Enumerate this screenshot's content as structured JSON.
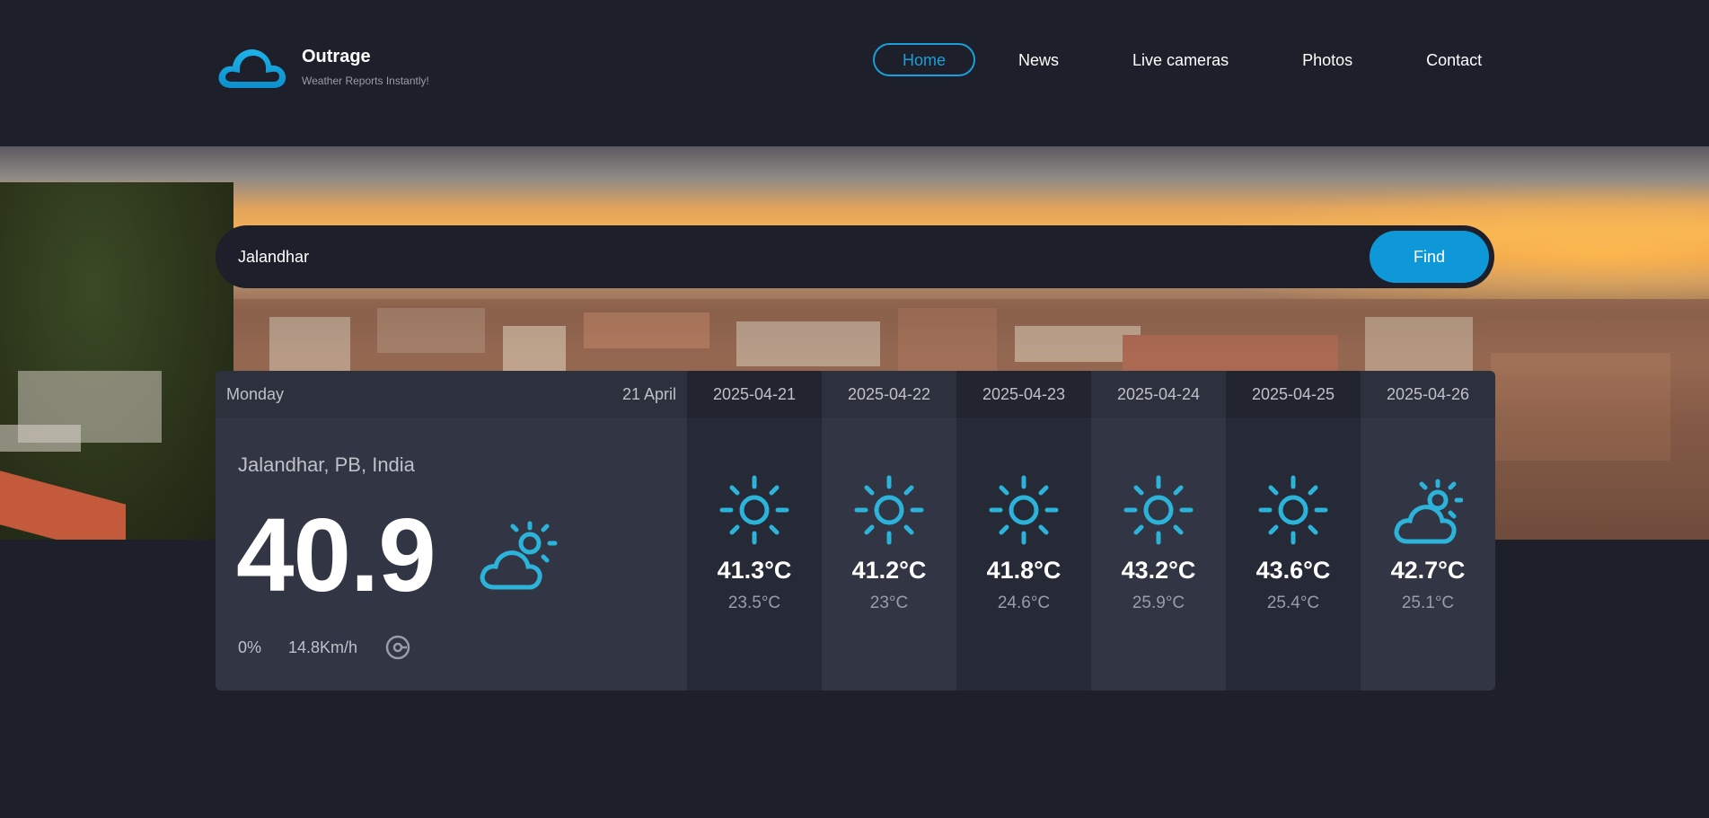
{
  "brand": {
    "name": "Outrage",
    "tagline": "Weather Reports Instantly!"
  },
  "nav": [
    {
      "label": "Home",
      "active": true
    },
    {
      "label": "News",
      "active": false
    },
    {
      "label": "Live cameras",
      "active": false
    },
    {
      "label": "Photos",
      "active": false
    },
    {
      "label": "Contact",
      "active": false
    }
  ],
  "search": {
    "value": "Jalandhar",
    "button_label": "Find"
  },
  "today": {
    "day": "Monday",
    "date": "21 April",
    "location": "Jalandhar, PB, India",
    "temperature": "40.9",
    "icon": "partly-cloudy-icon",
    "humidity": "0%",
    "wind": "14.8Km/h",
    "wind_icon": "compass-icon"
  },
  "forecast": [
    {
      "date": "2025-04-21",
      "max": "41.3°C",
      "min": "23.5°C",
      "icon": "sun-icon"
    },
    {
      "date": "2025-04-22",
      "max": "41.2°C",
      "min": "23°C",
      "icon": "sun-icon"
    },
    {
      "date": "2025-04-23",
      "max": "41.8°C",
      "min": "24.6°C",
      "icon": "sun-icon"
    },
    {
      "date": "2025-04-24",
      "max": "43.2°C",
      "min": "25.9°C",
      "icon": "sun-icon"
    },
    {
      "date": "2025-04-25",
      "max": "43.6°C",
      "min": "25.4°C",
      "icon": "sun-icon"
    },
    {
      "date": "2025-04-26",
      "max": "42.7°C",
      "min": "25.1°C",
      "icon": "partly-cloudy-icon"
    }
  ],
  "colors": {
    "accent": "#1a9fda",
    "button": "#0e98d8",
    "icon": "#2bb3da",
    "background": "#1d1f2b",
    "panel": "#323544"
  }
}
